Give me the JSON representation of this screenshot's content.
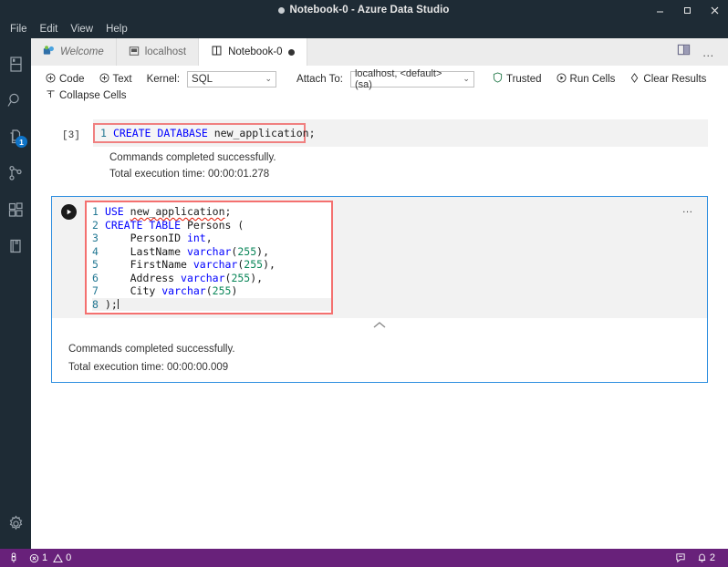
{
  "window": {
    "title": "Notebook-0 - Azure Data Studio",
    "dirty_dot": "●",
    "minimize_label": "Minimize",
    "maximize_label": "Maximize",
    "close_label": "Close"
  },
  "menubar": {
    "items": [
      {
        "label": "File"
      },
      {
        "label": "Edit"
      },
      {
        "label": "View"
      },
      {
        "label": "Help"
      }
    ]
  },
  "activitybar": {
    "items": [
      {
        "name": "explorer",
        "icon": "files-icon",
        "badge": ""
      },
      {
        "name": "search",
        "icon": "search-icon",
        "badge": ""
      },
      {
        "name": "source-control",
        "icon": "source-control-icon",
        "badge": "1"
      },
      {
        "name": "connections",
        "icon": "git-branch-icon",
        "badge": ""
      },
      {
        "name": "extensions",
        "icon": "extensions-icon",
        "badge": ""
      },
      {
        "name": "notebooks",
        "icon": "notebook-icon",
        "badge": ""
      }
    ],
    "settings": {
      "name": "manage",
      "icon": "gear-icon"
    }
  },
  "tabs": [
    {
      "label": "Welcome",
      "icon": "welcome-icon",
      "active": false,
      "italic": true,
      "dirty": false
    },
    {
      "label": "localhost",
      "icon": "server-icon",
      "active": false,
      "italic": false,
      "dirty": false
    },
    {
      "label": "Notebook-0",
      "icon": "notebook-icon",
      "active": true,
      "italic": false,
      "dirty": true
    }
  ],
  "tabbar_actions": {
    "split_editor": "split-editor-icon",
    "more_actions": "…"
  },
  "toolbar": {
    "code_label": "Code",
    "text_label": "Text",
    "kernel_label": "Kernel:",
    "kernel_value": "SQL",
    "attach_label": "Attach To:",
    "attach_value": "localhost, <default> (sa)",
    "trusted_label": "Trusted",
    "run_cells_label": "Run Cells",
    "clear_results_label": "Clear Results",
    "collapse_cells_label": "Collapse Cells"
  },
  "notebook": {
    "cells": [
      {
        "execution_count": "[3]",
        "active": false,
        "code_lines": [
          {
            "n": "1",
            "tokens": [
              {
                "t": "CREATE DATABASE ",
                "c": "kw"
              },
              {
                "t": "new_application;",
                "c": "plain"
              }
            ]
          }
        ],
        "outputs": [
          "Commands completed successfully.",
          "Total execution time: 00:00:01.278"
        ]
      },
      {
        "execution_count": "",
        "active": true,
        "run_button": "run-cell-icon",
        "more_actions": "…",
        "code_lines": [
          {
            "n": "1",
            "tokens": [
              {
                "t": "USE ",
                "c": "kw"
              },
              {
                "t": "new_application",
                "c": "squiggly"
              },
              {
                "t": ";",
                "c": "plain"
              }
            ]
          },
          {
            "n": "2",
            "tokens": [
              {
                "t": "CREATE TABLE ",
                "c": "kw"
              },
              {
                "t": "Persons (",
                "c": "plain"
              }
            ]
          },
          {
            "n": "3",
            "tokens": [
              {
                "t": "    PersonID ",
                "c": "plain"
              },
              {
                "t": "int",
                "c": "typ"
              },
              {
                "t": ",",
                "c": "plain"
              }
            ]
          },
          {
            "n": "4",
            "tokens": [
              {
                "t": "    LastName ",
                "c": "plain"
              },
              {
                "t": "varchar",
                "c": "typ"
              },
              {
                "t": "(",
                "c": "plain"
              },
              {
                "t": "255",
                "c": "num"
              },
              {
                "t": "),",
                "c": "plain"
              }
            ]
          },
          {
            "n": "5",
            "tokens": [
              {
                "t": "    FirstName ",
                "c": "plain"
              },
              {
                "t": "varchar",
                "c": "typ"
              },
              {
                "t": "(",
                "c": "plain"
              },
              {
                "t": "255",
                "c": "num"
              },
              {
                "t": "),",
                "c": "plain"
              }
            ]
          },
          {
            "n": "6",
            "tokens": [
              {
                "t": "    Address ",
                "c": "plain"
              },
              {
                "t": "varchar",
                "c": "typ"
              },
              {
                "t": "(",
                "c": "plain"
              },
              {
                "t": "255",
                "c": "num"
              },
              {
                "t": "),",
                "c": "plain"
              }
            ]
          },
          {
            "n": "7",
            "tokens": [
              {
                "t": "    City ",
                "c": "plain"
              },
              {
                "t": "varchar",
                "c": "typ"
              },
              {
                "t": "(",
                "c": "plain"
              },
              {
                "t": "255",
                "c": "num"
              },
              {
                "t": ")",
                "c": "plain"
              }
            ]
          },
          {
            "n": "8",
            "current": true,
            "tokens": [
              {
                "t": ");",
                "c": "plain"
              }
            ]
          }
        ],
        "outputs": [
          "Commands completed successfully.",
          "Total execution time: 00:00:00.009"
        ]
      }
    ]
  },
  "statusbar": {
    "left": [
      {
        "name": "remote",
        "icon": "remote-icon",
        "text": ""
      },
      {
        "name": "problems",
        "icon": "error-warning-icon",
        "error_count": "1",
        "warning_count": "0"
      }
    ],
    "right": [
      {
        "name": "feedback",
        "icon": "feedback-icon",
        "text": ""
      },
      {
        "name": "notifications",
        "icon": "bell-icon",
        "text": "2"
      }
    ]
  },
  "colors": {
    "titlebar_bg": "#1e2b35",
    "statusbar_bg": "#68217a",
    "accent_blue": "#2f8fe0",
    "selection_red": "#f4706f",
    "badge_blue": "#0f74c8",
    "keyword": "#0000ff",
    "number": "#098658",
    "line_number": "#237893"
  }
}
